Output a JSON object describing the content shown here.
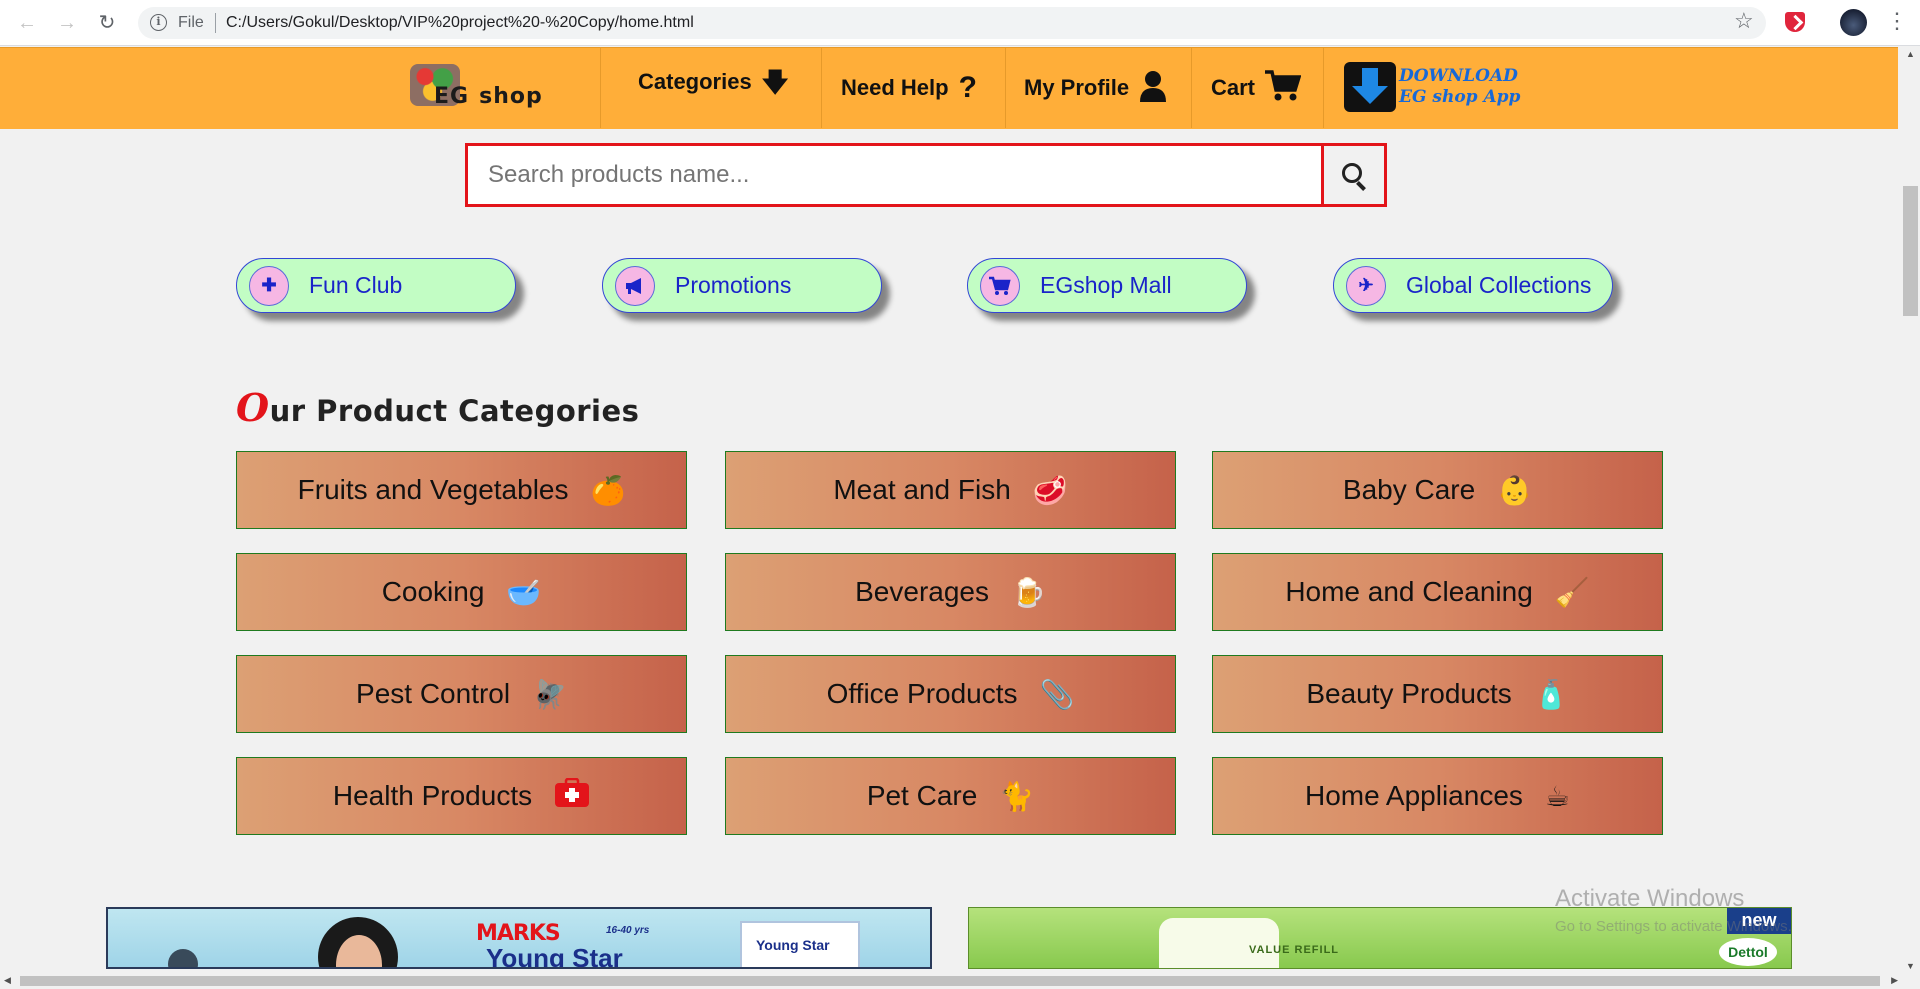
{
  "browser": {
    "file_label": "File",
    "url": "C:/Users/Gokul/Desktop/VIP%20project%20-%20Copy/home.html",
    "icons": [
      "back-arrow-icon",
      "forward-arrow-icon",
      "reload-icon",
      "info-icon",
      "star-icon",
      "extension-icon",
      "profile-avatar",
      "menu-dots-icon"
    ]
  },
  "header": {
    "logo_text_a": "EG",
    "logo_text_b": "shop",
    "nav": [
      {
        "label": "Categories",
        "icon": "arrow-down-icon",
        "glyph": "🡇"
      },
      {
        "label": "Need Help",
        "icon": "question-icon",
        "glyph": "?"
      },
      {
        "label": "My Profile",
        "icon": "user-icon",
        "glyph": "👤"
      },
      {
        "label": "Cart",
        "icon": "cart-icon",
        "glyph": "🛒"
      }
    ],
    "download_line1": "DOWNLOAD",
    "download_line2": "EG shop App",
    "background": "#ffae39"
  },
  "search": {
    "placeholder": "Search products name...",
    "value": ""
  },
  "quick_links": [
    {
      "label": "Fun Club",
      "icon": "puzzle-icon",
      "glyph": "✚"
    },
    {
      "label": "Promotions",
      "icon": "megaphone-icon",
      "glyph": "📢"
    },
    {
      "label": "EGshop Mall",
      "icon": "cart-icon",
      "glyph": "🛒"
    },
    {
      "label": "Global Collections",
      "icon": "plane-icon",
      "glyph": "✈"
    }
  ],
  "categories_section": {
    "title_first": "O",
    "title_rest": "ur Product Categories",
    "accent": "#e3141a"
  },
  "categories": [
    {
      "label": "Fruits and Vegetables",
      "icon": "fruit-icon",
      "glyph": "🍊"
    },
    {
      "label": "Meat and Fish",
      "icon": "meat-icon",
      "glyph": "🥩"
    },
    {
      "label": "Baby Care",
      "icon": "baby-icon",
      "glyph": "👶"
    },
    {
      "label": "Cooking",
      "icon": "bowl-icon",
      "glyph": "🥣"
    },
    {
      "label": "Beverages",
      "icon": "beer-mug-icon",
      "glyph": "🍺"
    },
    {
      "label": "Home and Cleaning",
      "icon": "broom-icon",
      "glyph": "🧹"
    },
    {
      "label": "Pest Control",
      "icon": "fly-icon",
      "glyph": "🪰"
    },
    {
      "label": "Office Products",
      "icon": "paperclip-icon",
      "glyph": "📎"
    },
    {
      "label": "Beauty Products",
      "icon": "lotion-icon",
      "glyph": "🧴"
    },
    {
      "label": "Health Products",
      "icon": "first-aid-icon",
      "glyph": "⛑"
    },
    {
      "label": "Pet Care",
      "icon": "cat-icon",
      "glyph": "🐈"
    },
    {
      "label": "Home Appliances",
      "icon": "mixer-icon",
      "glyph": "☕"
    }
  ],
  "banners": {
    "left_brand1": "MARKS",
    "left_brand2": "Young Star",
    "left_tagline": "16-40 yrs",
    "left_pack": "Young Star",
    "right_text": "VALUE REFILL",
    "right_badge": "new",
    "right_brand": "Dettol"
  },
  "watermark": {
    "line1": "Activate Windows",
    "line2": "Go to Settings to activate Windows."
  }
}
